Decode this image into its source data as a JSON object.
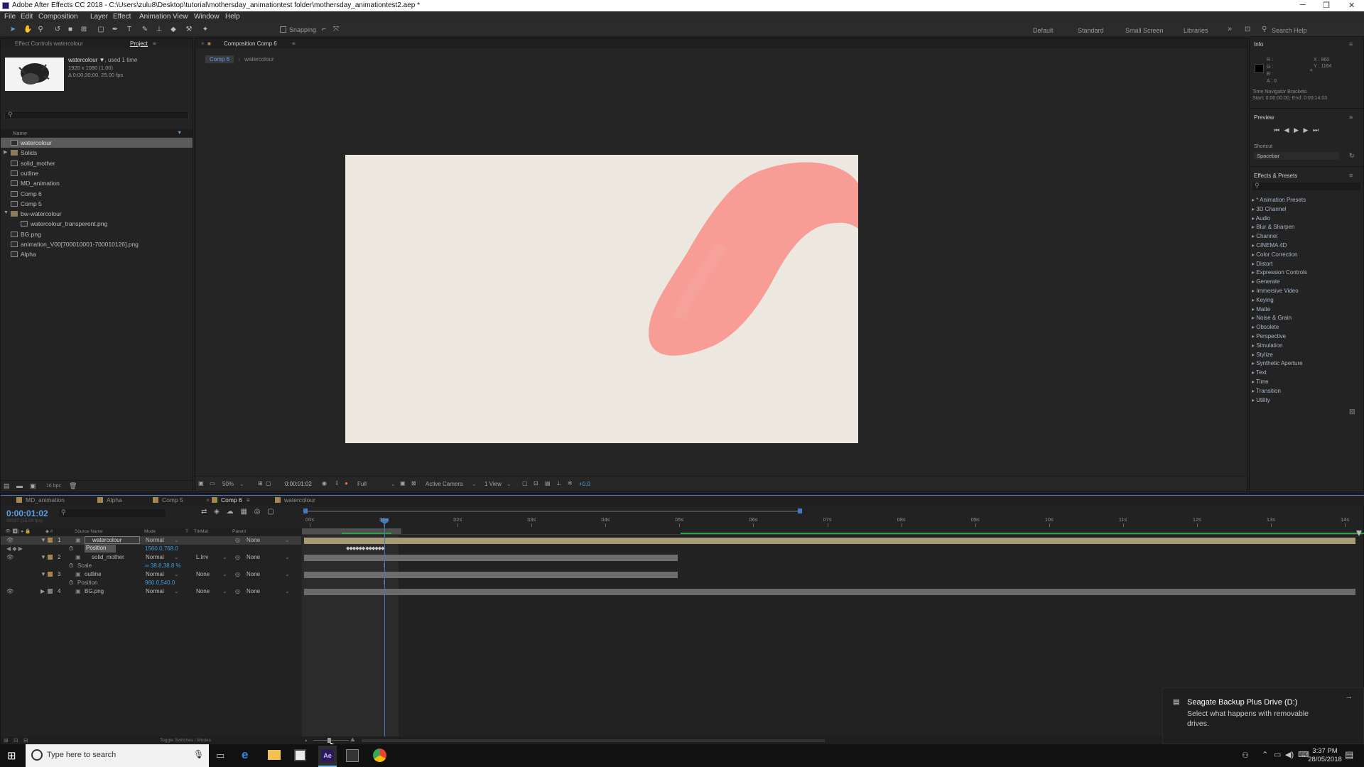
{
  "window": {
    "title": "Adobe After Effects CC 2018 - C:\\Users\\zulu8\\Desktop\\tutorial\\mothersday_animationtest folder\\mothersday_animationtest2.aep *"
  },
  "menu": [
    "File",
    "Edit",
    "Composition",
    "Layer",
    "Effect",
    "Animation",
    "View",
    "Window",
    "Help"
  ],
  "toolbar": {
    "snapping_label": "Snapping",
    "workspaces": [
      "Default",
      "Standard",
      "Small Screen",
      "Libraries"
    ],
    "search_help_placeholder": "Search Help"
  },
  "project_panel": {
    "tabs": [
      "Effect Controls watercolour",
      "Project"
    ],
    "asset_name": "watercolour ▼",
    "asset_used": ", used 1 time",
    "asset_line2": "1920 x 1080 (1.00)",
    "asset_line3": "Δ 0;00;30;00, 25.00 fps",
    "col_name": "Name",
    "items": [
      {
        "label": "watercolour",
        "kind": "comp",
        "indent": 0,
        "selected": true
      },
      {
        "label": "Solids",
        "kind": "folder",
        "indent": 0,
        "selected": false
      },
      {
        "label": "solid_mother",
        "kind": "comp",
        "indent": 0,
        "selected": false
      },
      {
        "label": "outline",
        "kind": "comp",
        "indent": 0,
        "selected": false
      },
      {
        "label": "MD_animation",
        "kind": "comp",
        "indent": 0,
        "selected": false
      },
      {
        "label": "Comp 6",
        "kind": "comp",
        "indent": 0,
        "selected": false
      },
      {
        "label": "Comp 5",
        "kind": "comp",
        "indent": 0,
        "selected": false
      },
      {
        "label": "bw-watercolour",
        "kind": "folder",
        "indent": 0,
        "selected": false
      },
      {
        "label": "watercolour_transperent.png",
        "kind": "file",
        "indent": 1,
        "selected": false
      },
      {
        "label": "BG.png",
        "kind": "file",
        "indent": 0,
        "selected": false
      },
      {
        "label": "animation_V00[700010001-700010126].png",
        "kind": "file",
        "indent": 0,
        "selected": false
      },
      {
        "label": "Alpha",
        "kind": "comp",
        "indent": 0,
        "selected": false
      }
    ],
    "bpc": "16 bpc"
  },
  "composition_panel": {
    "tab": "Composition Comp 6",
    "crumbs": [
      "Comp 6",
      "watercolour"
    ],
    "zoom": "50%",
    "timecode": "0:00:01:02",
    "resolution": "Full",
    "camera": "Active Camera",
    "views": "1 View",
    "exposure": "+0.0",
    "canvas_bg": "#ece7df",
    "stroke_color": "#f8978e"
  },
  "info_panel": {
    "title": "Info",
    "r": "R :",
    "g": "G :",
    "b": "B :",
    "a": "A : 0",
    "x": "X : 960",
    "y": "Y : 1164",
    "nav_title": "Time Navigator Brackets",
    "nav_range": "Start: 0:00:00:00, End: 0:00:14:03"
  },
  "preview_panel": {
    "title": "Preview",
    "shortcut_label": "Shortcut",
    "shortcut_value": "Spacebar"
  },
  "effects_panel": {
    "title": "Effects & Presets",
    "items": [
      "* Animation Presets",
      "3D Channel",
      "Audio",
      "Blur & Sharpen",
      "Channel",
      "CINEMA 4D",
      "Color Correction",
      "Distort",
      "Expression Controls",
      "Generate",
      "Immersive Video",
      "Keying",
      "Matte",
      "Noise & Grain",
      "Obsolete",
      "Perspective",
      "Simulation",
      "Stylize",
      "Synthetic Aperture",
      "Text",
      "Time",
      "Transition",
      "Utility"
    ]
  },
  "timeline": {
    "tabs": [
      {
        "label": "MD_animation",
        "color": "#a4844f",
        "active": false
      },
      {
        "label": "Alpha",
        "color": "#a4844f",
        "active": false
      },
      {
        "label": "Comp 5",
        "color": "#a4844f",
        "active": false
      },
      {
        "label": "Comp 6",
        "color": "#a4844f",
        "active": true
      },
      {
        "label": "watercolour",
        "color": "#a4844f",
        "active": false
      }
    ],
    "current_time": "0:00:01:02",
    "frame_rate_hint": "00027 (25.00 fps)",
    "headers": {
      "source": "Source Name",
      "mode": "Mode",
      "t": "T",
      "trkmat": "TrkMat",
      "parent": "Parent"
    },
    "ruler": [
      "00s",
      "01s",
      "02s",
      "03s",
      "04s",
      "05s",
      "06s",
      "07s",
      "08s",
      "09s",
      "10s",
      "11s",
      "12s",
      "13s",
      "14s"
    ],
    "layers": [
      {
        "num": "1",
        "name": "watercolour",
        "mode": "Normal",
        "trkmat": "",
        "parent": "None",
        "selected": true,
        "prop": "Position",
        "prop_value": "1560.0,768.0"
      },
      {
        "num": "2",
        "name": "solid_mother",
        "mode": "Normal",
        "trkmat": "L.Inv",
        "parent": "None",
        "selected": false,
        "prop": "Scale",
        "prop_value": "∞ 38.8,38.8 %"
      },
      {
        "num": "3",
        "name": "outline",
        "mode": "Normal",
        "trkmat": "None",
        "parent": "None",
        "selected": false,
        "prop": "Position",
        "prop_value": "960.0,540.0"
      },
      {
        "num": "4",
        "name": "BG.png",
        "mode": "Normal",
        "trkmat": "None",
        "parent": "None",
        "selected": false,
        "prop": "",
        "prop_value": ""
      }
    ],
    "footer_label": "Toggle Switches / Modes"
  },
  "notification": {
    "title": "Seagate Backup Plus Drive (D:)",
    "body": "Select what happens with removable drives."
  },
  "taskbar": {
    "search_placeholder": "Type here to search",
    "time": "3:37 PM",
    "date": "28/05/2018"
  }
}
